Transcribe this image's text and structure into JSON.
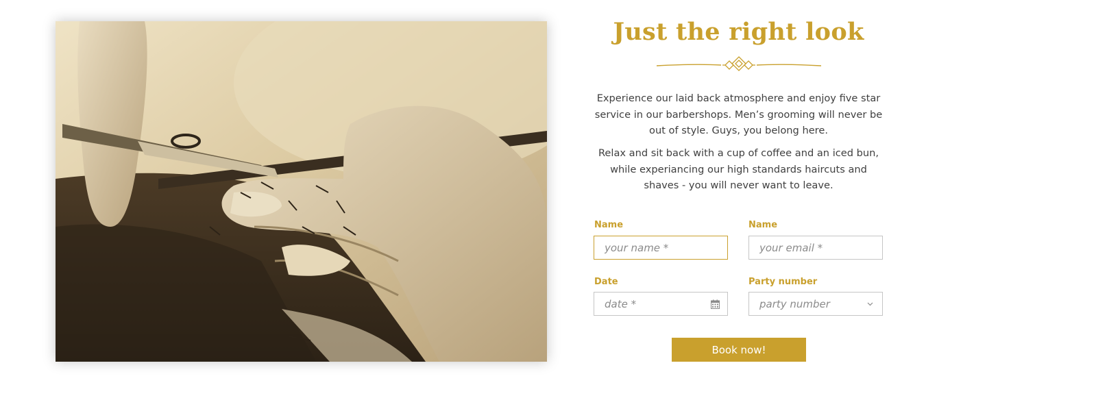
{
  "heading": "Just the right look",
  "paragraphs": [
    "Experience our laid back atmosphere and enjoy five star service in our barbershops. Men’s grooming will never be out of style. Guys, you belong here.",
    "Relax and sit back with a cup of coffee and an iced bun, while experiancing our high standards haircuts and shaves - you will never want to leave."
  ],
  "form": {
    "name": {
      "label": "Name",
      "placeholder": "your name *"
    },
    "email": {
      "label": "Name",
      "placeholder": "your email *"
    },
    "date": {
      "label": "Date",
      "placeholder": "date *",
      "icon": "calendar-icon"
    },
    "party": {
      "label": "Party number",
      "selected": "party number",
      "icon": "chevron-down-icon"
    },
    "submit_label": "Book now!"
  },
  "colors": {
    "accent": "#c9a02d",
    "text": "#3f3f3f",
    "border": "#c5c5c5"
  }
}
